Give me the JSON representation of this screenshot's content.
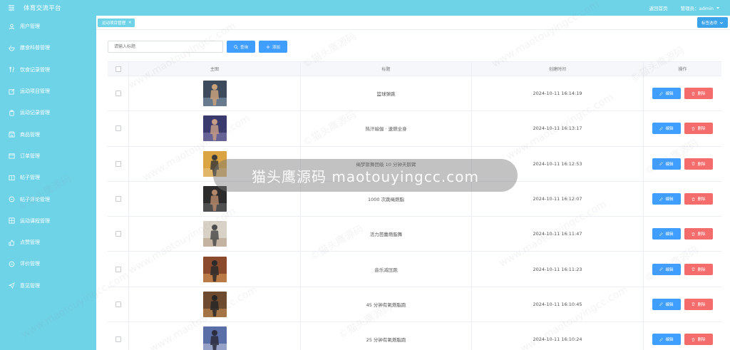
{
  "header": {
    "title": "体育交流平台",
    "home_link": "返回首页",
    "admin_label": "管理员：admin"
  },
  "sidebar": {
    "items": [
      {
        "label": "用户管理",
        "icon": "user-icon"
      },
      {
        "label": "膳食科普管理",
        "icon": "food-bowl-icon"
      },
      {
        "label": "饮食记录管理",
        "icon": "utensils-icon"
      },
      {
        "label": "运动项目管理",
        "icon": "edit-square-icon"
      },
      {
        "label": "运动记录管理",
        "icon": "clipboard-icon"
      },
      {
        "label": "商品管理",
        "icon": "shop-icon"
      },
      {
        "label": "订单管理",
        "icon": "order-icon"
      },
      {
        "label": "帖子管理",
        "icon": "book-icon"
      },
      {
        "label": "帖子评论管理",
        "icon": "comment-icon"
      },
      {
        "label": "运动课程管理",
        "icon": "grid-icon"
      },
      {
        "label": "点赞管理",
        "icon": "thumbs-up-icon"
      },
      {
        "label": "评价管理",
        "icon": "chat-icon"
      },
      {
        "label": "意见管理",
        "icon": "send-icon"
      }
    ]
  },
  "tags": {
    "active": "运动项目管理",
    "options_label": "标签选项"
  },
  "search": {
    "placeholder": "请输入标题",
    "query_label": "查询",
    "add_label": "添加"
  },
  "table": {
    "columns": [
      "主图",
      "标题",
      "创建时间",
      "操作"
    ],
    "edit_label": "编辑",
    "delete_label": "删除",
    "rows": [
      {
        "title": "篮球弹跳",
        "created": "2024-10-11 16:14:19",
        "colors": [
          "#3e4b5c",
          "#c9a17a",
          "#88a2b8"
        ]
      },
      {
        "title": "热汗瑜伽 · 速燃全身",
        "created": "2024-10-11 16:13:17",
        "colors": [
          "#3a3a6e",
          "#c69c86",
          "#8b83b8"
        ]
      },
      {
        "title": "绳梦斯舞团级 10 分钟天鹅臂",
        "created": "2024-10-11 16:12:53",
        "colors": [
          "#d9a441",
          "#3d3b38",
          "#e7c48a"
        ]
      },
      {
        "title": "1000 次跳绳燃脂",
        "created": "2024-10-11 16:12:07",
        "colors": [
          "#2c2c2c",
          "#b3876a",
          "#6d6d6d"
        ]
      },
      {
        "title": "活力芭蕾燃脂舞",
        "created": "2024-10-11 16:11:47",
        "colors": [
          "#d8d1c6",
          "#4d4d4d",
          "#b49a84"
        ]
      },
      {
        "title": "音乐减压跑",
        "created": "2024-10-11 16:11:23",
        "colors": [
          "#8b4a2b",
          "#2b2b2b",
          "#e2a35c"
        ]
      },
      {
        "title": "45 分钟有氧燃脂跑",
        "created": "2024-10-11 16:10:45",
        "colors": [
          "#6e4a2e",
          "#262626",
          "#d49757"
        ]
      },
      {
        "title": "25 分钟有氧燃脂跑",
        "created": "2024-10-11 16:10:24",
        "colors": [
          "#5a6fa8",
          "#2c2c3c",
          "#c7cbe0"
        ]
      }
    ]
  },
  "watermark": {
    "banner": "猫头鹰源码 maotouyingcc.com",
    "tile_text": "www.maotouyingcc.com",
    "tile_text_cn": "©猫头鹰源码"
  },
  "colors": {
    "primary": "#6fd3e8",
    "button_blue": "#409eff",
    "button_red": "#f56c6c"
  }
}
